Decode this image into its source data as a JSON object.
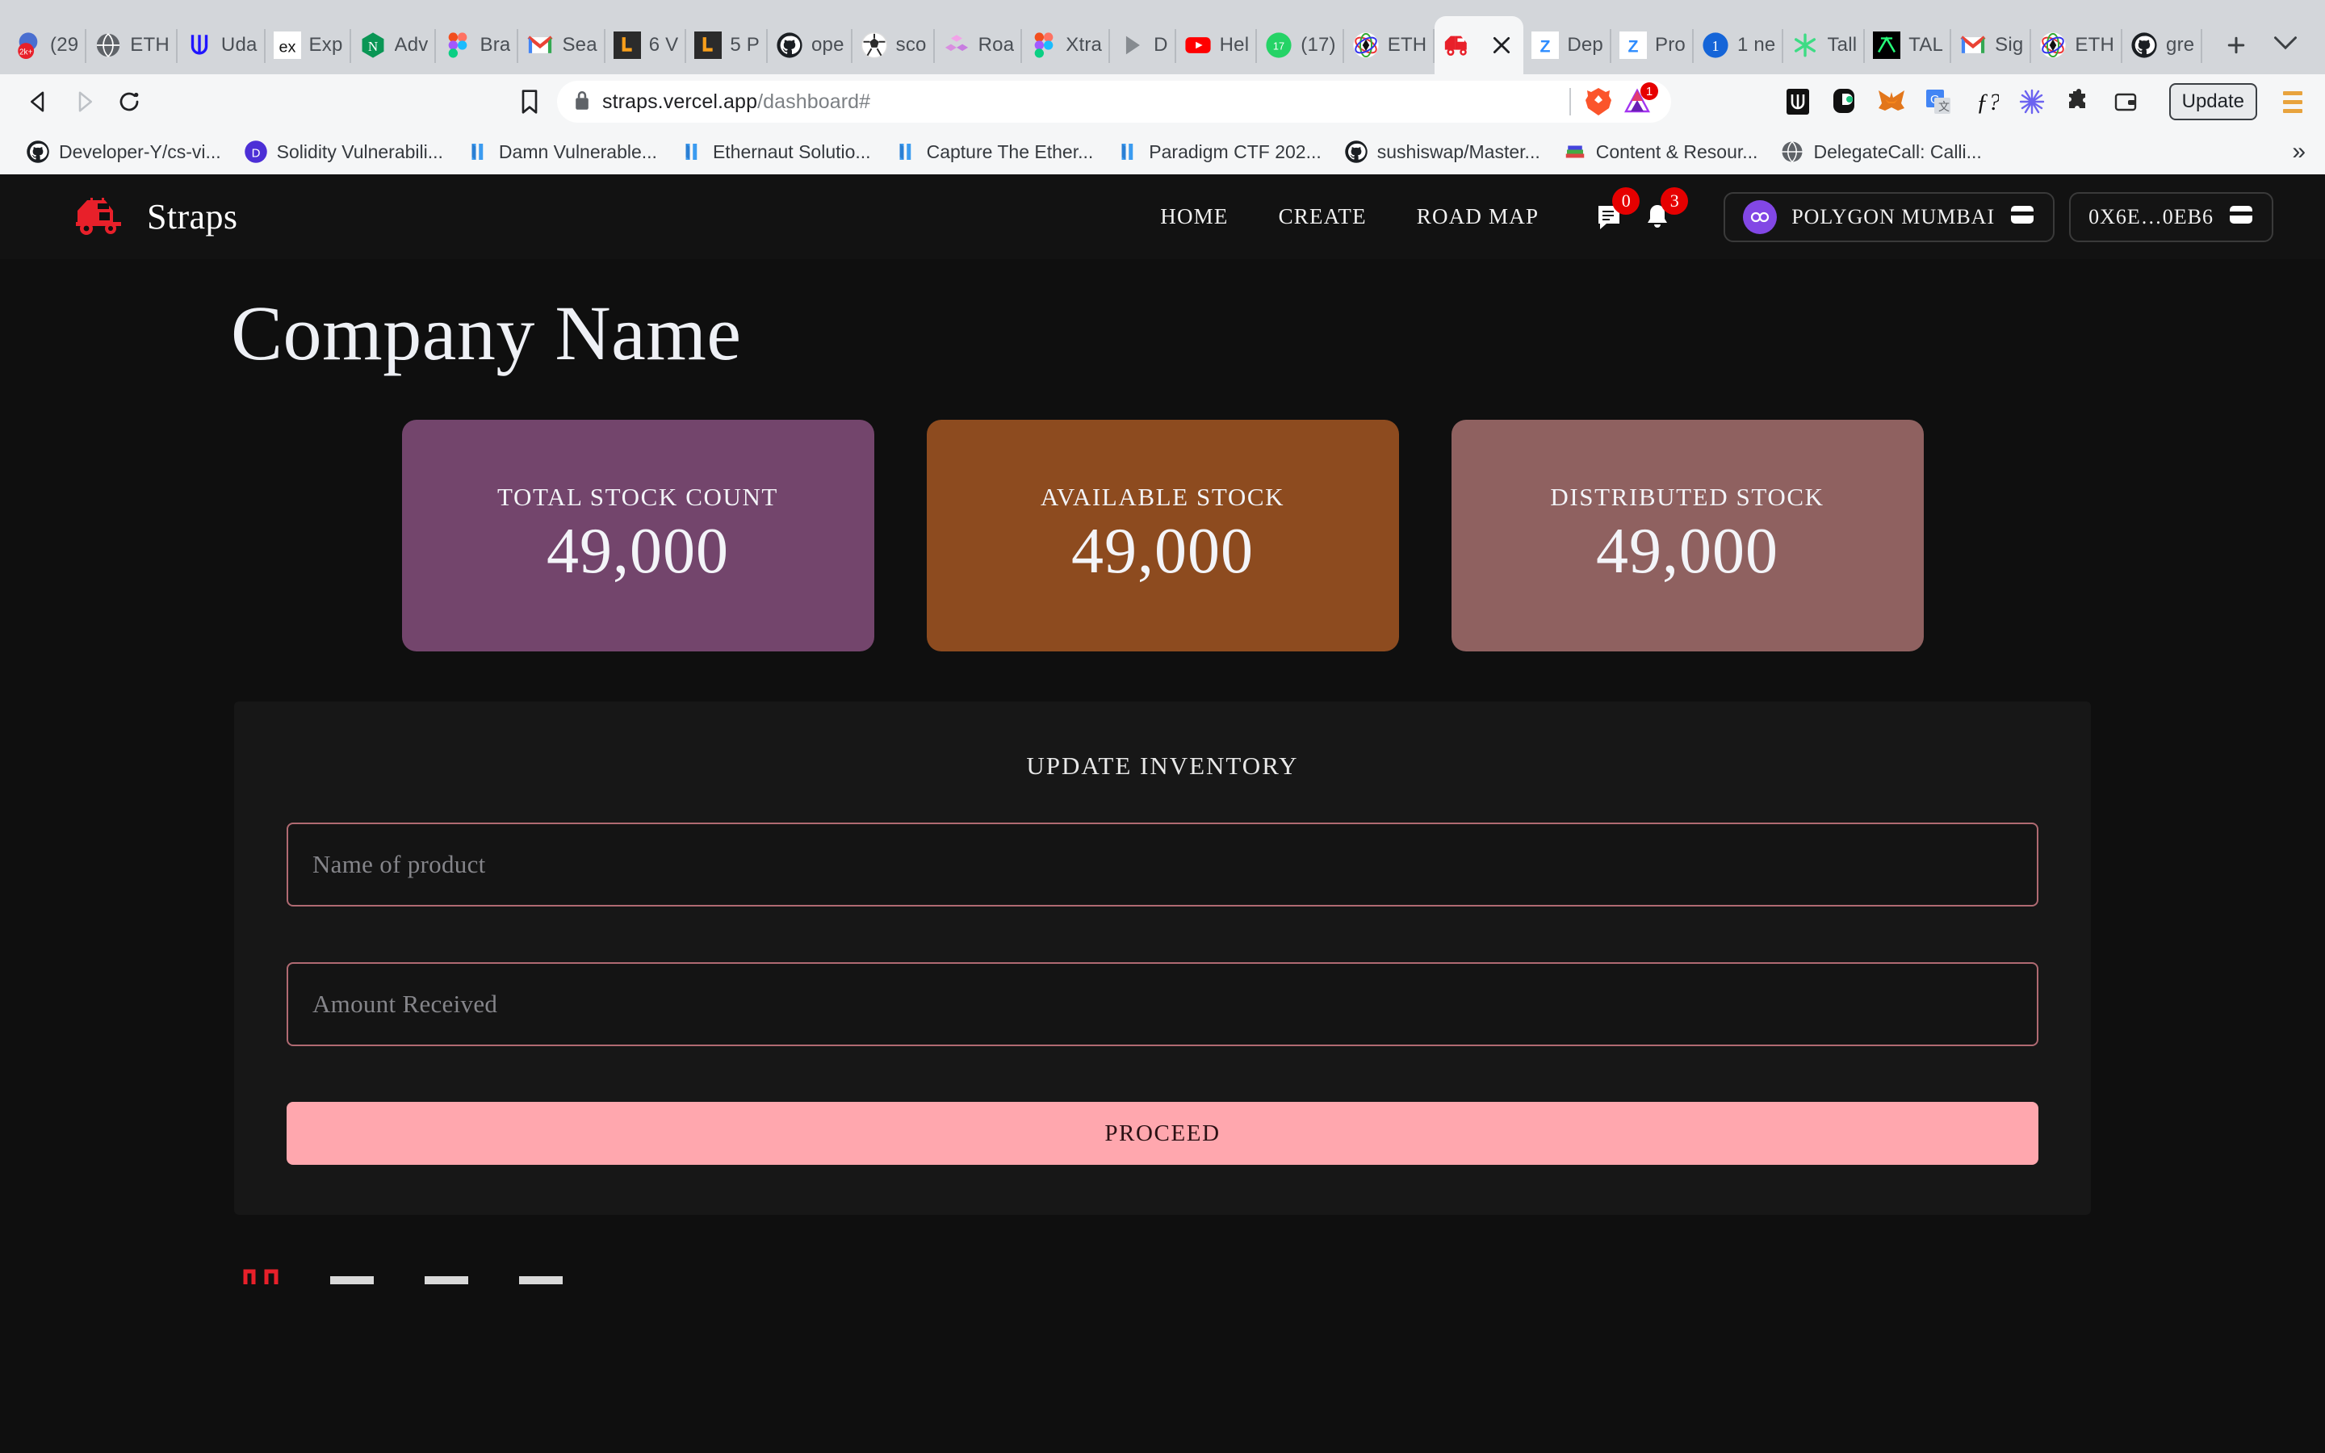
{
  "browser": {
    "tabs": [
      {
        "label": "(29",
        "icon": "gmail-badge-icon",
        "active": false
      },
      {
        "label": "ETH",
        "icon": "globe-icon",
        "active": false
      },
      {
        "label": "Uda",
        "icon": "udacity-icon",
        "active": false
      },
      {
        "label": "Exp",
        "icon": "ex-icon",
        "active": false
      },
      {
        "label": "Adv",
        "icon": "nextjs-icon",
        "active": false
      },
      {
        "label": "Bra",
        "icon": "figma-icon",
        "active": false
      },
      {
        "label": "Sea",
        "icon": "gmail-icon",
        "active": false
      },
      {
        "label": "6 V",
        "icon": "leetcode-icon",
        "active": false
      },
      {
        "label": "5 P",
        "icon": "leetcode-icon",
        "active": false
      },
      {
        "label": "ope",
        "icon": "github-icon",
        "active": false
      },
      {
        "label": "sco",
        "icon": "football-icon",
        "active": false
      },
      {
        "label": "Roa",
        "icon": "cubes-icon",
        "active": false
      },
      {
        "label": "Xtra",
        "icon": "figma-icon",
        "active": false
      },
      {
        "label": "D",
        "icon": "play-icon",
        "active": false
      },
      {
        "label": "Hel",
        "icon": "youtube-icon",
        "active": false
      },
      {
        "label": "(17)",
        "icon": "whatsapp-icon",
        "active": false
      },
      {
        "label": "ETH",
        "icon": "ethglobal-icon",
        "active": false
      },
      {
        "label": "",
        "icon": "straps-truck-icon",
        "active": true
      },
      {
        "label": "Dep",
        "icon": "zoom-icon",
        "active": false
      },
      {
        "label": "Pro",
        "icon": "zoom-icon",
        "active": false
      },
      {
        "label": "1 ne",
        "icon": "one-icon",
        "active": false
      },
      {
        "label": "Tall",
        "icon": "tally-icon",
        "active": false
      },
      {
        "label": "TAL",
        "icon": "tal-icon",
        "active": false
      },
      {
        "label": "Sig",
        "icon": "gmail-icon",
        "active": false
      },
      {
        "label": "ETH",
        "icon": "ethglobal-icon",
        "active": false
      },
      {
        "label": "gre",
        "icon": "github-icon",
        "active": false
      }
    ],
    "new_tab_label": "+",
    "toolbar": {
      "back_icon": "back-arrow-icon",
      "forward_icon": "forward-arrow-icon",
      "reload_icon": "reload-icon",
      "bookmark_icon": "bookmark-icon",
      "lock_icon": "lock-icon",
      "url_main": "straps.vercel.app",
      "url_path": "/dashboard#",
      "shield_badge": "1",
      "update_label": "Update",
      "extensions": [
        "brave-lion-icon",
        "brave-rewards-icon",
        "metamask-alt-icon",
        "phantom-icon",
        "metamask-fox-icon",
        "google-translate-icon",
        "formula-icon",
        "snowflake-icon",
        "puzzle-extension-icon",
        "wallet-icon"
      ]
    },
    "bookmarks": [
      {
        "label": "Developer-Y/cs-vi...",
        "icon": "github-icon"
      },
      {
        "label": "Solidity Vulnerabili...",
        "icon": "d-circle-icon"
      },
      {
        "label": "Damn Vulnerable...",
        "icon": "ethereum-blue-icon"
      },
      {
        "label": "Ethernaut Solutio...",
        "icon": "ethereum-blue-icon"
      },
      {
        "label": "Capture The Ether...",
        "icon": "ethereum-blue-icon"
      },
      {
        "label": "Paradigm CTF 202...",
        "icon": "ethereum-blue-icon"
      },
      {
        "label": "sushiswap/Master...",
        "icon": "github-icon"
      },
      {
        "label": "Content & Resour...",
        "icon": "books-icon"
      },
      {
        "label": "DelegateCall: Calli...",
        "icon": "globe-icon"
      }
    ],
    "bookmarks_overflow_label": "»"
  },
  "site": {
    "brand_name": "Straps",
    "brand_icon": "red-truck-logo-icon",
    "nav_links": [
      {
        "label": "HOME"
      },
      {
        "label": "CREATE"
      },
      {
        "label": "ROAD MAP"
      }
    ],
    "chat_icon": "chat-bubble-icon",
    "chat_badge": "0",
    "bell_icon": "bell-icon",
    "bell_badge": "3",
    "network": {
      "label": "POLYGON MUMBAI",
      "icon": "polygon-icon",
      "wallet_icon": "wallet-icon",
      "accent": "#8247e5"
    },
    "account": {
      "address": "0X6E…0EB6",
      "wallet_icon": "wallet-icon"
    }
  },
  "main": {
    "title": "Company Name",
    "cards": [
      {
        "title": "TOTAL STOCK COUNT",
        "value": "49,000",
        "color": "#73456c"
      },
      {
        "title": "AVAILABLE STOCK",
        "value": "49,000",
        "color": "#8d4b1f"
      },
      {
        "title": "DISTRIBUTED STOCK",
        "value": "49,000",
        "color": "#8f6160"
      }
    ],
    "form": {
      "heading": "UPDATE INVENTORY",
      "product_placeholder": "Name of product",
      "amount_placeholder": "Amount Received",
      "submit_label": "PROCEED",
      "border_color": "#b06a72",
      "submit_color": "#ffa7ae"
    }
  }
}
